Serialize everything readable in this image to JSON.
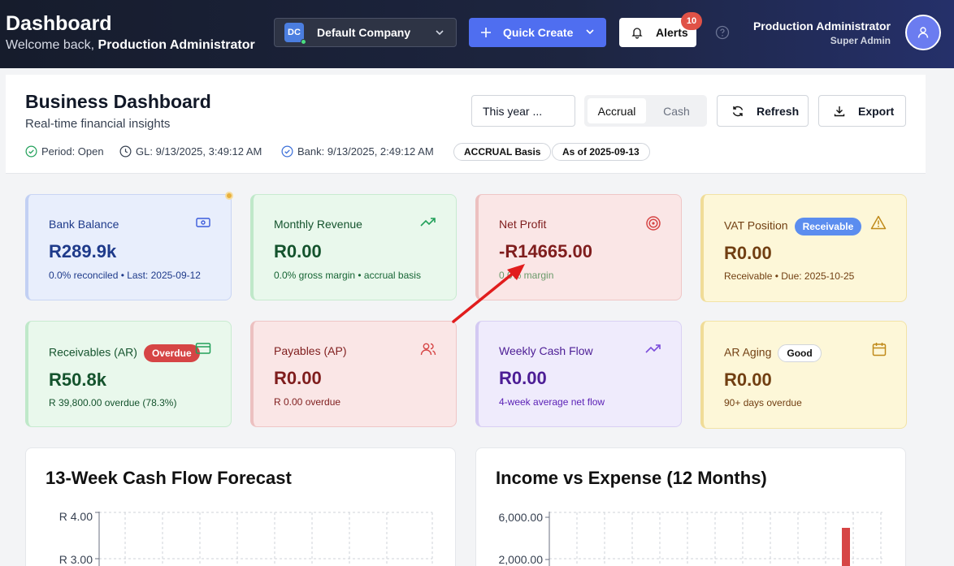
{
  "topbar": {
    "title": "Dashboard",
    "welcome_prefix": "Welcome back, ",
    "welcome_name": "Production Administrator",
    "company_initials": "DC",
    "company_name": "Default Company",
    "quick_create": "Quick Create",
    "alerts_label": "Alerts",
    "alerts_count": "10",
    "user_name": "Production Administrator",
    "user_role": "Super Admin"
  },
  "header": {
    "title": "Business Dashboard",
    "subtitle": "Real-time financial insights",
    "period_status": "Period: Open",
    "gl_timestamp": "GL: 9/13/2025, 3:49:12 AM",
    "bank_timestamp": "Bank: 9/13/2025, 2:49:12 AM",
    "basis_pill": "ACCRUAL Basis",
    "asof_pill": "As of 2025-09-13",
    "period_select": "This year ...",
    "basis_options": [
      "Accrual",
      "Cash"
    ],
    "basis_selected": "Accrual",
    "refresh_label": "Refresh",
    "export_label": "Export"
  },
  "cards": [
    {
      "label": "Bank Balance",
      "value": "R289.9k",
      "note": "0.0% reconciled • Last: 2025-09-12",
      "icon": "banknote-icon"
    },
    {
      "label": "Monthly Revenue",
      "value": "R0.00",
      "note": "0.0% gross margin • accrual basis",
      "icon": "trending-up-icon"
    },
    {
      "label": "Net Profit",
      "value": "-R14665.00",
      "note": "0.0% margin",
      "icon": "target-icon"
    },
    {
      "label": "VAT Position",
      "tag": "Receivable",
      "value": "R0.00",
      "note": "Receivable • Due: 2025-10-25",
      "icon": "warning-icon"
    },
    {
      "label": "Receivables (AR)",
      "tag": "Overdue",
      "value": "R50.8k",
      "note": "R 39,800.00 overdue (78.3%)",
      "icon": "credit-card-icon"
    },
    {
      "label": "Payables (AP)",
      "value": "R0.00",
      "note": "R 0.00 overdue",
      "icon": "users-icon"
    },
    {
      "label": "Weekly Cash Flow",
      "value": "R0.00",
      "note": "4-week average net flow",
      "icon": "trending-up-icon"
    },
    {
      "label": "AR Aging",
      "tag": "Good",
      "value": "R0.00",
      "note": "90+ days overdue",
      "icon": "calendar-icon"
    }
  ],
  "charts": {
    "cashflow": {
      "title": "13-Week Cash Flow Forecast",
      "y_ticks": [
        "R 4.00",
        "R 3.00"
      ]
    },
    "income_expense": {
      "title": "Income vs Expense (12 Months)",
      "y_ticks": [
        "6,000.00",
        "2,000.00"
      ]
    }
  },
  "chart_data": [
    {
      "type": "line",
      "title": "13-Week Cash Flow Forecast",
      "y_ticks": [
        "R 4.00",
        "R 3.00"
      ],
      "grid": true
    },
    {
      "type": "bar",
      "title": "Income vs Expense (12 Months)",
      "y_ticks": [
        "6,000.00",
        "2,000.00"
      ],
      "grid": true
    }
  ],
  "colors": {
    "primary": "#4f6ef0",
    "danger": "#e05247",
    "card_value_blue": "#1e3a8a",
    "card_value_green": "#14532d",
    "card_value_red": "#7f1d1d",
    "card_value_brown": "#713f12",
    "card_value_purple": "#4c1d95"
  }
}
